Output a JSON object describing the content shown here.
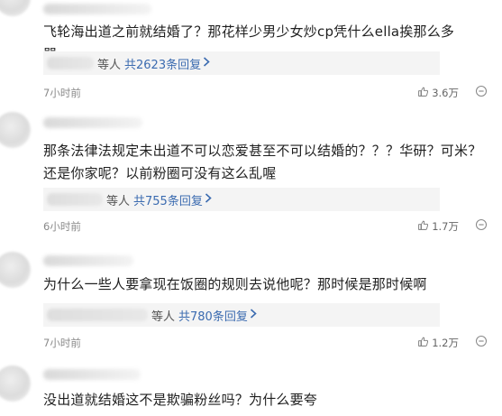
{
  "comments": [
    {
      "text": "飞轮海出道之前就结婚了？那花样少男少女炒cp凭什么ella挨那么多骂……",
      "reply_suffix": "等人",
      "reply_count": "共2623条回复",
      "time": "7小时前",
      "likes": "3.6万"
    },
    {
      "text": "那条法律法规定未出道不可以恋爱甚至不可以结婚的？？？华研？可米？还是你家呢？以前粉圈可没有这么乱喔",
      "reply_suffix": "等人",
      "reply_count": "共755条回复",
      "time": "6小时前",
      "likes": "1.7万"
    },
    {
      "text": "为什么一些人要拿现在饭圈的规则去说他呢？那时候是那时候啊",
      "reply_suffix": "等人",
      "reply_count": "共780条回复",
      "time": "7小时前",
      "likes": "1.2万"
    },
    {
      "text": "没出道就结婚这不是欺骗粉丝吗？为什么要夸"
    }
  ],
  "icons": {
    "like": "thumbs-up-icon",
    "more": "more-circle-icon",
    "chevron": "chevron-right-icon"
  }
}
